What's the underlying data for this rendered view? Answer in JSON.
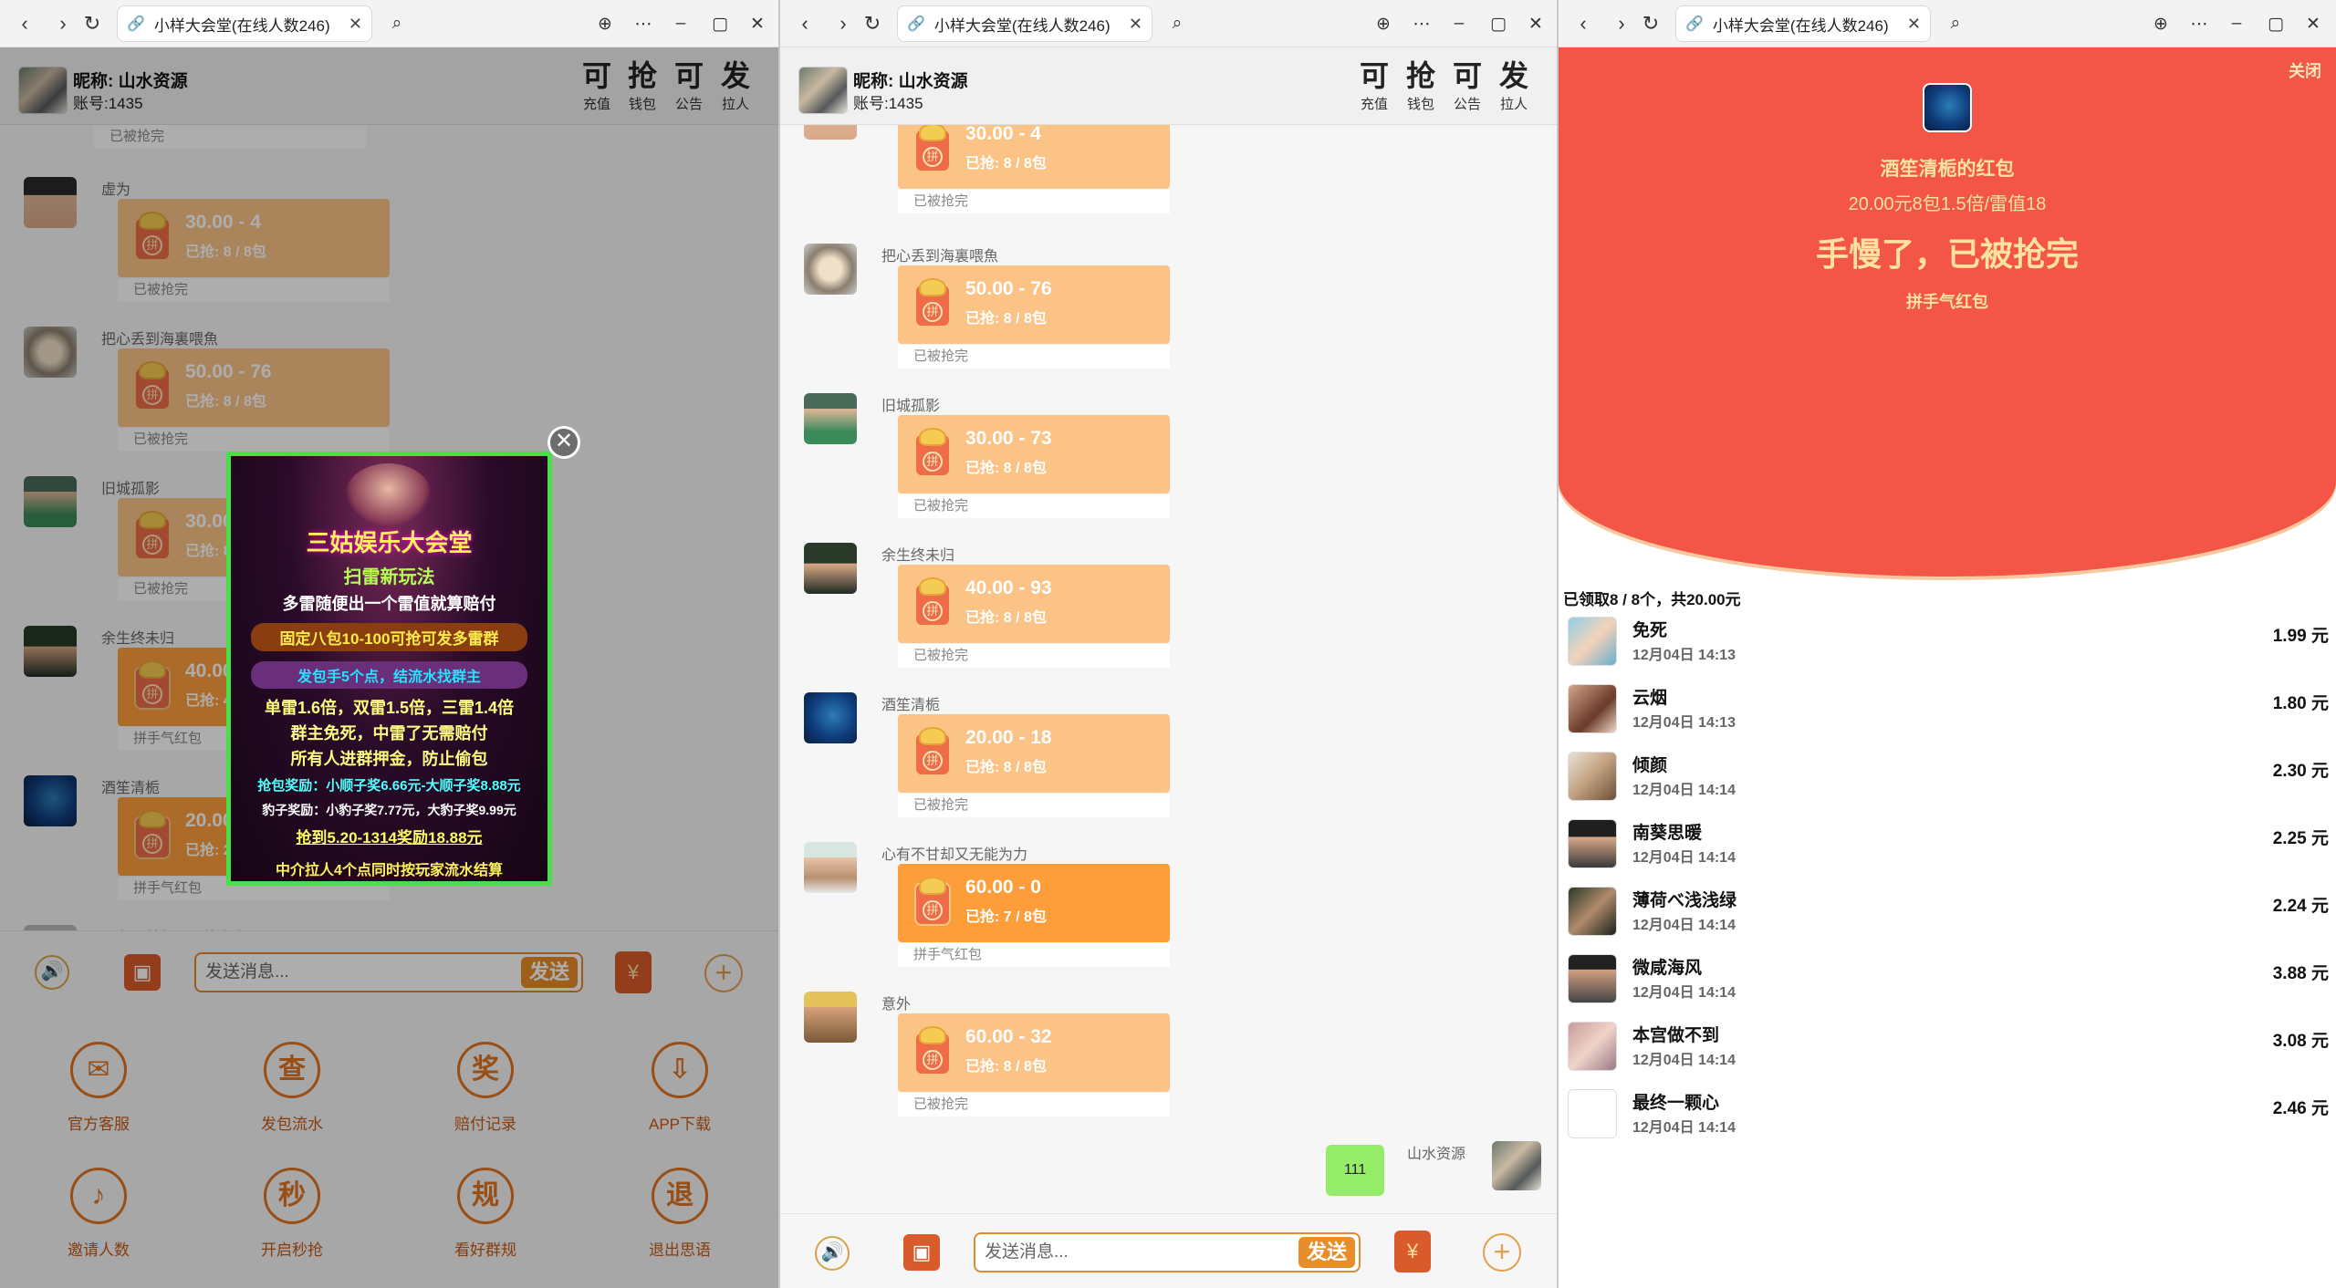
{
  "windows": [
    {
      "tab_title": "小样大会堂(在线人数246)"
    },
    {
      "tab_title": "小样大会堂(在线人数246)"
    },
    {
      "tab_title": "小样大会堂(在线人数246)"
    }
  ],
  "header": {
    "nickname": "昵称: 山水资源",
    "account": "账号:1435",
    "buttons": [
      {
        "big": "可",
        "small": "充值"
      },
      {
        "big": "抢",
        "small": "钱包"
      },
      {
        "big": "可",
        "small": "公告"
      },
      {
        "big": "发",
        "small": "拉人"
      }
    ]
  },
  "left_chat": {
    "top_status": "已被抢完",
    "messages": [
      {
        "name": "虚为",
        "amount": "30.00 - 4",
        "grabbed": "已抢: 8 / 8包",
        "status": "已被抢完"
      },
      {
        "name": "把心丢到海裏喂魚",
        "amount": "50.00 - 76",
        "grabbed": "已抢: 8 / 8包",
        "status": "已被抢完"
      },
      {
        "name": "旧城孤影",
        "amount": "30.00 - 73",
        "grabbed": "已抢: 8 / 8包",
        "status": "已被抢完"
      },
      {
        "name": "余生终未归",
        "amount": "40.00 - 93",
        "grabbed": "已抢: 4 / 8包",
        "status": "拼手气红包"
      },
      {
        "name": "酒笙清栀",
        "amount": "20.00 - 18",
        "grabbed": "已抢: 2 / 8包",
        "status": "拼手气红包"
      }
    ],
    "cut_name": "心有不甘却又无能为力"
  },
  "ad": {
    "close": "✕",
    "lines": [
      "三姑娱乐大会堂",
      "扫雷新玩法",
      "多雷随便出一个雷值就算赔付",
      "固定八包10-100可抢可发多雷群",
      "发包手5个点，结流水找群主",
      "单雷1.6倍，双雷1.5倍，三雷1.4倍",
      "群主免死，中雷了无需赔付",
      "所有人进群押金，防止偷包",
      "抢包奖励：小顺子奖6.66元-大顺子奖8.88元",
      "豹子奖励：小豹子奖7.77元，大豹子奖9.99元",
      "抢到5.20-1314奖励18.88元",
      "中介拉人4个点同时按玩家流水结算"
    ]
  },
  "input": {
    "placeholder": "发送消息...",
    "send": "发送",
    "yuan": "¥",
    "voice": "🔊",
    "image": "▣",
    "plus": "+"
  },
  "grid": [
    {
      "icon": "✉",
      "label": "官方客服"
    },
    {
      "icon": "查",
      "label": "发包流水"
    },
    {
      "icon": "奖",
      "label": "赔付记录"
    },
    {
      "icon": "⇩",
      "label": "APP下载"
    },
    {
      "icon": "♪",
      "label": "邀请人数"
    },
    {
      "icon": "秒",
      "label": "开启秒抢"
    },
    {
      "icon": "规",
      "label": "看好群规"
    },
    {
      "icon": "退",
      "label": "退出思语"
    }
  ],
  "mid_chat": {
    "messages": [
      {
        "name": "",
        "amount": "30.00 - 4",
        "grabbed": "已抢: 8 / 8包",
        "status": "已被抢完"
      },
      {
        "name": "把心丢到海裏喂魚",
        "amount": "50.00 - 76",
        "grabbed": "已抢: 8 / 8包",
        "status": "已被抢完"
      },
      {
        "name": "旧城孤影",
        "amount": "30.00 - 73",
        "grabbed": "已抢: 8 / 8包",
        "status": "已被抢完"
      },
      {
        "name": "余生终未归",
        "amount": "40.00 - 93",
        "grabbed": "已抢: 8 / 8包",
        "status": "已被抢完"
      },
      {
        "name": "酒笙清栀",
        "amount": "20.00 - 18",
        "grabbed": "已抢: 8 / 8包",
        "status": "已被抢完"
      },
      {
        "name": "心有不甘却又无能为力",
        "amount": "60.00 - 0",
        "grabbed": "已抢: 7 / 8包",
        "status": "拼手气红包"
      },
      {
        "name": "意外",
        "amount": "60.00 - 32",
        "grabbed": "已抢: 8 / 8包",
        "status": "已被抢完"
      }
    ],
    "my_message": {
      "name": "山水资源",
      "text": "111"
    }
  },
  "detail": {
    "close": "关闭",
    "title": "酒笙清栀的红包",
    "info": "20.00元8包1.5倍/雷值18",
    "big": "手慢了，已被抢完",
    "kind": "拼手气红包",
    "summary": "已领取8 / 8个，共20.00元",
    "rows": [
      {
        "name": "免死",
        "time": "12月04日 14:13",
        "amount": "1.99 元"
      },
      {
        "name": "云烟",
        "time": "12月04日 14:13",
        "amount": "1.80 元"
      },
      {
        "name": "倾颜",
        "time": "12月04日 14:14",
        "amount": "2.30 元"
      },
      {
        "name": "南葵思暖",
        "time": "12月04日 14:14",
        "amount": "2.25 元"
      },
      {
        "name": "薄荷べ浅浅绿",
        "time": "12月04日 14:14",
        "amount": "2.24 元"
      },
      {
        "name": "微咸海风",
        "time": "12月04日 14:14",
        "amount": "3.88 元"
      },
      {
        "name": "本宫做不到",
        "time": "12月04日 14:14",
        "amount": "3.08 元"
      },
      {
        "name": "最终一颗心",
        "time": "12月04日 14:14",
        "amount": "2.46 元"
      }
    ]
  },
  "colors": {
    "accent": "#e78d29",
    "packet": "#fbc385",
    "packet_hot": "#fe9e3b",
    "red": "#f35547",
    "mine": "#95ec69"
  }
}
